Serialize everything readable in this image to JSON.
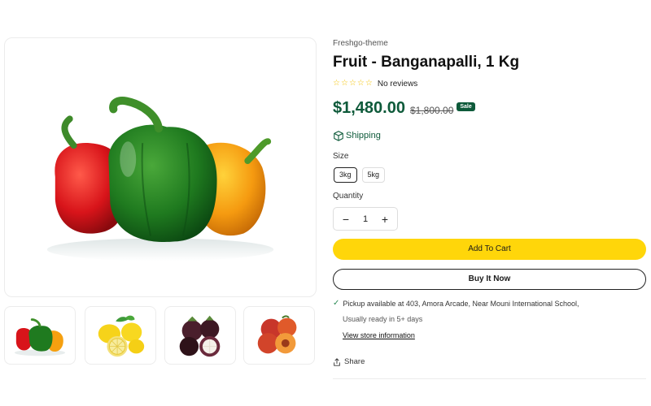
{
  "product": {
    "vendor": "Freshgo-theme",
    "title": "Fruit - Banganapalli, 1 Kg",
    "reviews_text": "No reviews",
    "rating_stars": 0,
    "price": "$1,480.00",
    "compare_price": "$1,800.00",
    "sale_badge": "Sale",
    "shipping_label": "Shipping"
  },
  "options": {
    "size_label": "Size",
    "sizes": [
      "3kg",
      "5kg"
    ],
    "selected_size": "3kg",
    "quantity_label": "Quantity",
    "quantity": "1",
    "minus": "−",
    "plus": "+"
  },
  "actions": {
    "add_to_cart": "Add To Cart",
    "buy_now": "Buy It Now",
    "share": "Share"
  },
  "pickup": {
    "check": "✓",
    "text": "Pickup available at 403, Amora Arcade, Near Mouni International School,",
    "ready": "Usually ready in 5+ days",
    "store_link": "View store information"
  },
  "gallery": {
    "main": "bell-peppers",
    "thumbnails": [
      "bell-peppers",
      "lemons",
      "mangosteen",
      "peaches"
    ]
  },
  "colors": {
    "accent_green": "#0e5a3a",
    "cart_yellow": "#ffd60a",
    "star": "#f4c300"
  }
}
